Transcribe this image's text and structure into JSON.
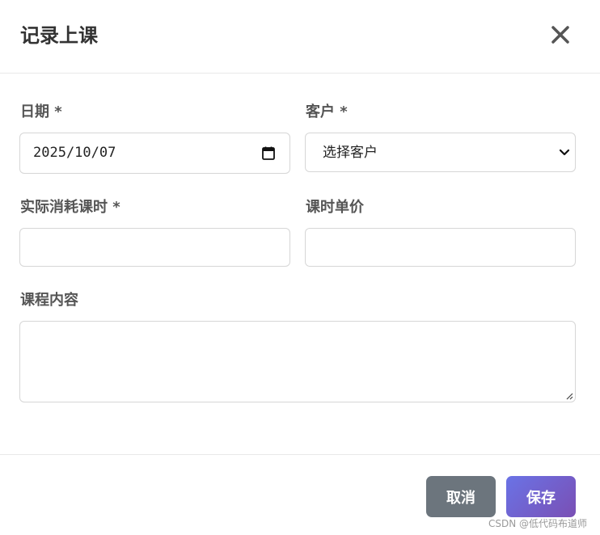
{
  "dialog": {
    "title": "记录上课"
  },
  "form": {
    "date": {
      "label": "日期 *",
      "value": "2025/10/07"
    },
    "customer": {
      "label": "客户 *",
      "selected": "选择客户"
    },
    "hours": {
      "label": "实际消耗课时 *",
      "value": ""
    },
    "unit_price": {
      "label": "课时单价",
      "value": ""
    },
    "content": {
      "label": "课程内容",
      "value": ""
    }
  },
  "footer": {
    "cancel_label": "取消",
    "save_label": "保存"
  },
  "watermark": "CSDN @低代码布道师",
  "colors": {
    "cancel_bg": "#6c757d",
    "save_gradient_start": "#6a73e6",
    "save_gradient_end": "#7a4fb4"
  },
  "icons": {
    "close": "close-icon",
    "calendar": "calendar-icon",
    "dropdown": "chevron-down-icon",
    "resize": "resize-handle-icon"
  }
}
